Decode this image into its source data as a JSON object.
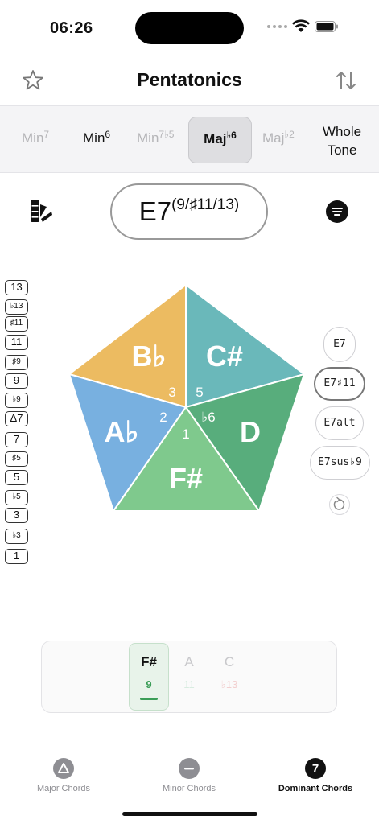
{
  "status_bar": {
    "time": "06:26"
  },
  "header": {
    "title": "Pentatonics"
  },
  "scale_tabs": {
    "min7": {
      "base": "Min",
      "sup": "7"
    },
    "min6": {
      "base": "Min",
      "sup": "6"
    },
    "min7b5": {
      "base": "Min",
      "sup": "7♭5"
    },
    "majb6": {
      "base": "Maj",
      "sup": "♭6"
    },
    "majb2": {
      "base": "Maj",
      "sup": "♭2"
    },
    "whole_tone": {
      "line1": "Whole",
      "line2": "Tone"
    }
  },
  "chord": {
    "root": "E7",
    "extensions": "(9/♯11/13)"
  },
  "intervals": [
    "13",
    "♭13",
    "♯11",
    "11",
    "♯9",
    "9",
    "♭9",
    "Δ7",
    "7",
    "♯5",
    "5",
    "♭5",
    "3",
    "♭3",
    "1"
  ],
  "pentagon": {
    "notes": [
      "B♭",
      "C#",
      "A♭",
      "D",
      "F#"
    ],
    "degrees": [
      "3",
      "5",
      "2",
      "♭6",
      "1"
    ],
    "colors": {
      "top_left": "#ecbb61",
      "top_right": "#6ab8ba",
      "left": "#78b0e0",
      "right": "#58ad7c",
      "bottom": "#7fc98d"
    }
  },
  "chord_buttons": [
    "E7",
    "E7♯11",
    "E7alt",
    "E7sus♭9"
  ],
  "note_strip": {
    "notes": [
      {
        "note": "F#",
        "degree": "9",
        "color": "#3a9d57"
      },
      {
        "note": "A",
        "degree": "11",
        "color": "#d8ece0"
      },
      {
        "note": "C",
        "degree": "♭13",
        "color": "#f2cfcf"
      }
    ]
  },
  "tab_bar": {
    "major": {
      "label": "Major Chords",
      "glyph": "△"
    },
    "minor": {
      "label": "Minor Chords",
      "glyph": "−"
    },
    "dominant": {
      "label": "Dominant Chords",
      "glyph": "7"
    }
  }
}
